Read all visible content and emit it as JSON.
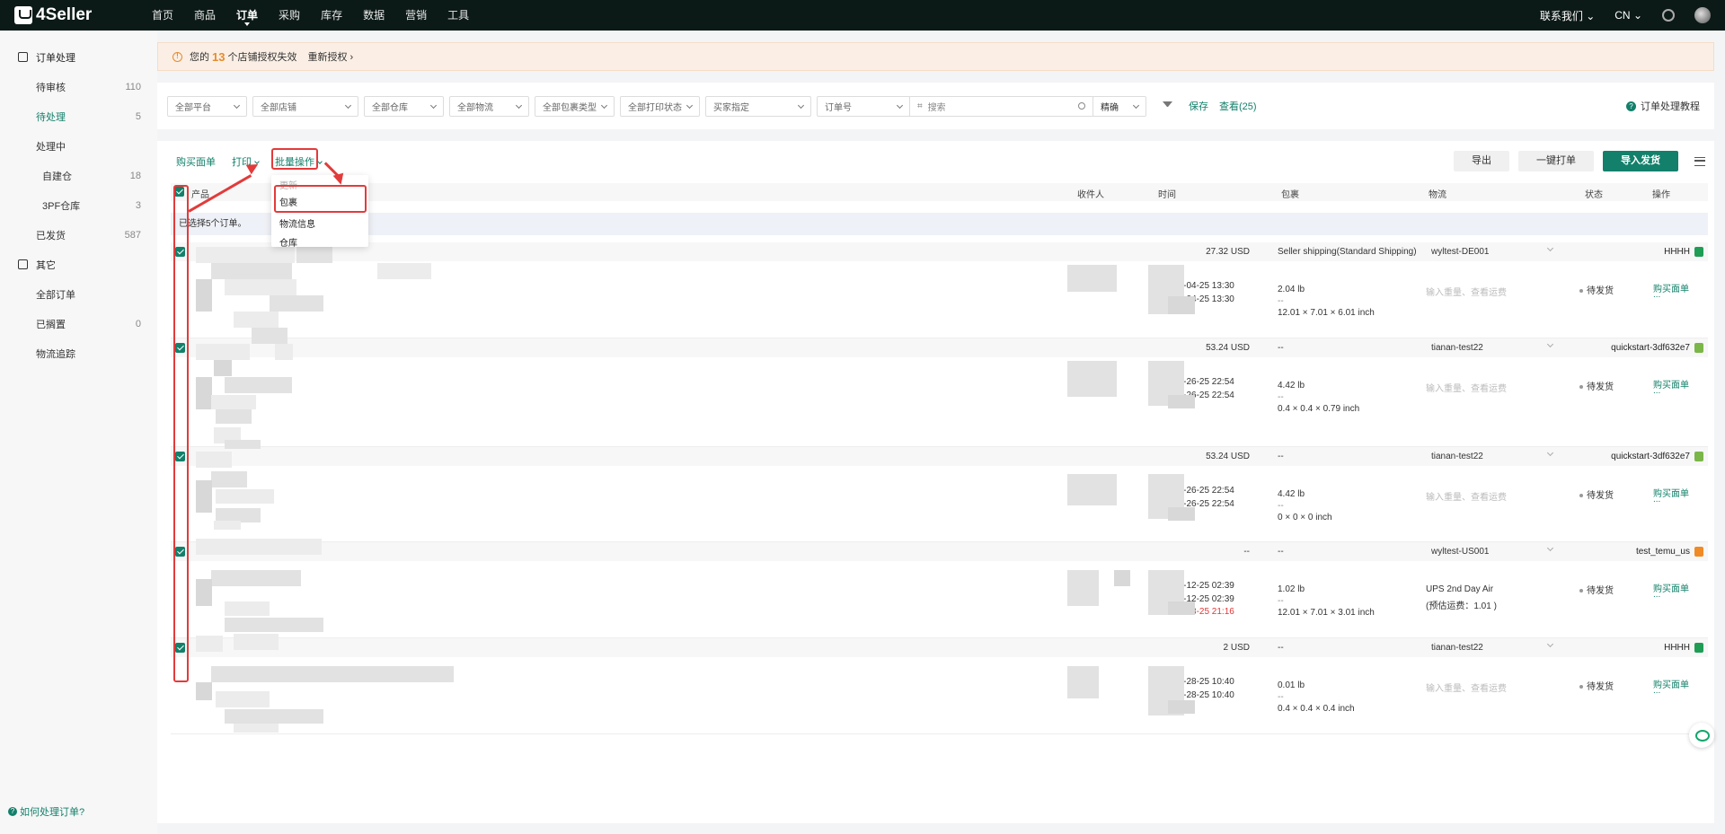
{
  "topnav": {
    "brand": "4Seller",
    "items": [
      "首页",
      "商品",
      "订单",
      "采购",
      "库存",
      "数据",
      "营销",
      "工具"
    ],
    "active": "订单",
    "contact": "联系我们",
    "lang": "CN"
  },
  "sidebar": {
    "group1": "订单处理",
    "items": [
      {
        "label": "待审核",
        "count": "110"
      },
      {
        "label": "待处理",
        "count": "5"
      },
      {
        "label": "处理中",
        "count": ""
      },
      {
        "label": "自建仓",
        "count": "18"
      },
      {
        "label": "3PF仓库",
        "count": "3"
      },
      {
        "label": "已发货",
        "count": "587"
      }
    ],
    "group2": "其它",
    "items2": [
      {
        "label": "全部订单",
        "count": ""
      },
      {
        "label": "已搁置",
        "count": "0"
      },
      {
        "label": "物流追踪",
        "count": ""
      }
    ],
    "help": "如何处理订单?"
  },
  "alert": {
    "prefix": "您的",
    "number": "13",
    "suffix": "个店铺授权失效",
    "action": "重新授权"
  },
  "filters": {
    "platform": "全部平台",
    "shop": "全部店铺",
    "warehouse": "全部仓库",
    "logistics": "全部物流",
    "package_type": "全部包裹类型",
    "print_status": "全部打印状态",
    "buyer": "买家指定",
    "order_no": "订单号",
    "search_placeholder": "搜索",
    "match": "精确",
    "save": "保存",
    "view": "查看(25)",
    "tutorial": "订单处理教程"
  },
  "toolbar": {
    "buy_label": "购买面单",
    "print": "打印",
    "batch": "批量操作",
    "export": "导出",
    "one_click": "一键打单",
    "import_ship": "导入发货"
  },
  "menu": {
    "items": [
      "更新",
      "包裹",
      "物流信息",
      "仓库"
    ]
  },
  "table": {
    "headers": [
      "产品",
      "收件人",
      "时间",
      "包裹",
      "物流",
      "状态",
      "操作"
    ],
    "selected_text": "已选择5个订单。"
  },
  "orders": [
    {
      "amount": "27.32 USD",
      "shipping": "Seller shipping(Standard Shipping)",
      "account": "wyltest-DE001",
      "store": "HHHH",
      "badge_color": "#1f9d55",
      "time1": "03-04-25 13:30",
      "time2": "03-04-25 13:30",
      "time3": "",
      "weight": "2.04 lb",
      "dims": "12.01 × 7.01 × 6.01 inch",
      "logi": "输入重量、查看运费",
      "logi2": "",
      "status": "待发货",
      "action": "购买面单"
    },
    {
      "amount": "53.24 USD",
      "shipping": "--",
      "account": "tianan-test22",
      "store": "quickstart-3df632e7",
      "badge_color": "#7ab648",
      "time1": "04-26-25 22:54",
      "time2": "04-26-25 22:54",
      "time3": "",
      "weight": "4.42 lb",
      "dims": "0.4 × 0.4 × 0.79 inch",
      "logi": "输入重量、查看运费",
      "logi2": "",
      "status": "待发货",
      "action": "购买面单"
    },
    {
      "amount": "53.24 USD",
      "shipping": "--",
      "account": "tianan-test22",
      "store": "quickstart-3df632e7",
      "badge_color": "#7ab648",
      "time1": "04-26-25 22:54",
      "time2": "04-26-25 22:54",
      "time3": "",
      "weight": "4.42 lb",
      "dims": "0 × 0 × 0 inch",
      "logi": "输入重量、查看运费",
      "logi2": "",
      "status": "待发货",
      "action": "购买面单"
    },
    {
      "amount": "--",
      "shipping": "--",
      "account": "wyltest-US001",
      "store": "test_temu_us",
      "badge_color": "#f08a24",
      "time1": "05-12-25 02:39",
      "time2": "05-12-25 02:39",
      "time3": "05-13-25 21:16",
      "weight": "1.02 lb",
      "dims": "12.01 × 7.01 × 3.01 inch",
      "logi": "UPS 2nd Day Air",
      "logi2": "(预估运费：1.01 )",
      "status": "待发货",
      "action": "购买面单"
    },
    {
      "amount": "2 USD",
      "shipping": "--",
      "account": "tianan-test22",
      "store": "HHHH",
      "badge_color": "#1f9d55",
      "time1": "05-28-25 10:40",
      "time2": "05-28-25 10:40",
      "time3": "",
      "weight": "0.01 lb",
      "dims": "0.4 × 0.4 × 0.4 inch",
      "logi": "输入重量、查看运费",
      "logi2": "",
      "status": "待发货",
      "action": "购买面单"
    }
  ],
  "dashes": "--",
  "ellipsis": "..."
}
